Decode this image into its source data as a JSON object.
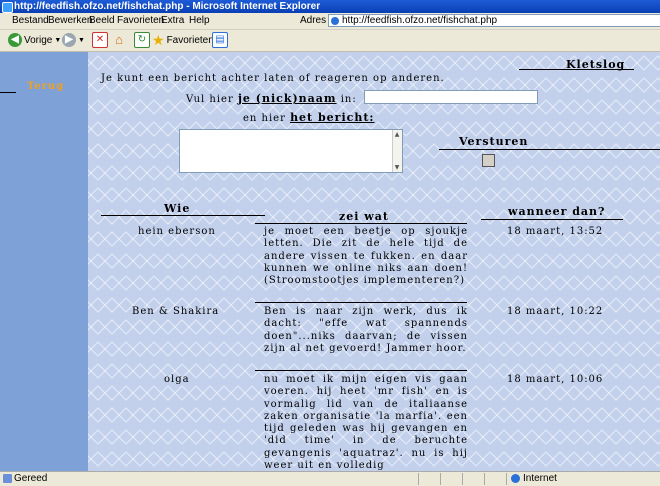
{
  "window": {
    "title": "http://feedfish.ofzo.net/fishchat.php - Microsoft Internet Explorer"
  },
  "menu": {
    "items": [
      "Bestand",
      "Bewerken",
      "Beeld",
      "Favorieten",
      "Extra",
      "Help"
    ]
  },
  "address": {
    "label": "Adres",
    "url": "http://feedfish.ofzo.net/fishchat.php"
  },
  "toolbar": {
    "back_label": "Vorige",
    "favorites_label": "Favorieten"
  },
  "page": {
    "back_link": "Terug",
    "title": "Kletslog",
    "intro": "Je kunt een bericht achter laten of reageren op anderen.",
    "nick_prefix": "Vul hier",
    "nick_bold": "je (nick)naam",
    "nick_suffix": "in:",
    "msg_prefix": "en hier",
    "msg_bold": "het bericht:",
    "send_label": "Versturen",
    "nick_value": "",
    "msg_value": ""
  },
  "table": {
    "headers": {
      "who": "Wie",
      "what": "zei wat",
      "when": "wanneer dan?"
    },
    "rows": [
      {
        "who": "hein eberson",
        "what": "je moet een beetje op sjoukje letten. Die zit de hele tijd de andere vissen te fukken. en daar kunnen we online niks aan doen! (Stroomstootjes implementeren?)",
        "when": "18 maart, 13:52"
      },
      {
        "who": "Ben & Shakira",
        "what": "Ben is naar zijn werk, dus ik dacht: \"effe wat spannends doen\"...niks daarvan; de vissen zijn al net gevoerd! Jammer hoor.",
        "when": "18 maart, 10:22"
      },
      {
        "who": "olga",
        "what": "nu moet ik mijn eigen vis gaan voeren. hij heet 'mr fish' en is vormalig lid van de italiaanse zaken organisatie 'la marfia'. een tijd geleden was hij gevangen en 'did time' in de beruchte gevangenis 'aquatraz'. nu is hij weer uit en volledig",
        "when": "18 maart, 10:06"
      }
    ]
  },
  "status": {
    "left": "Gereed",
    "zone": "Internet"
  }
}
